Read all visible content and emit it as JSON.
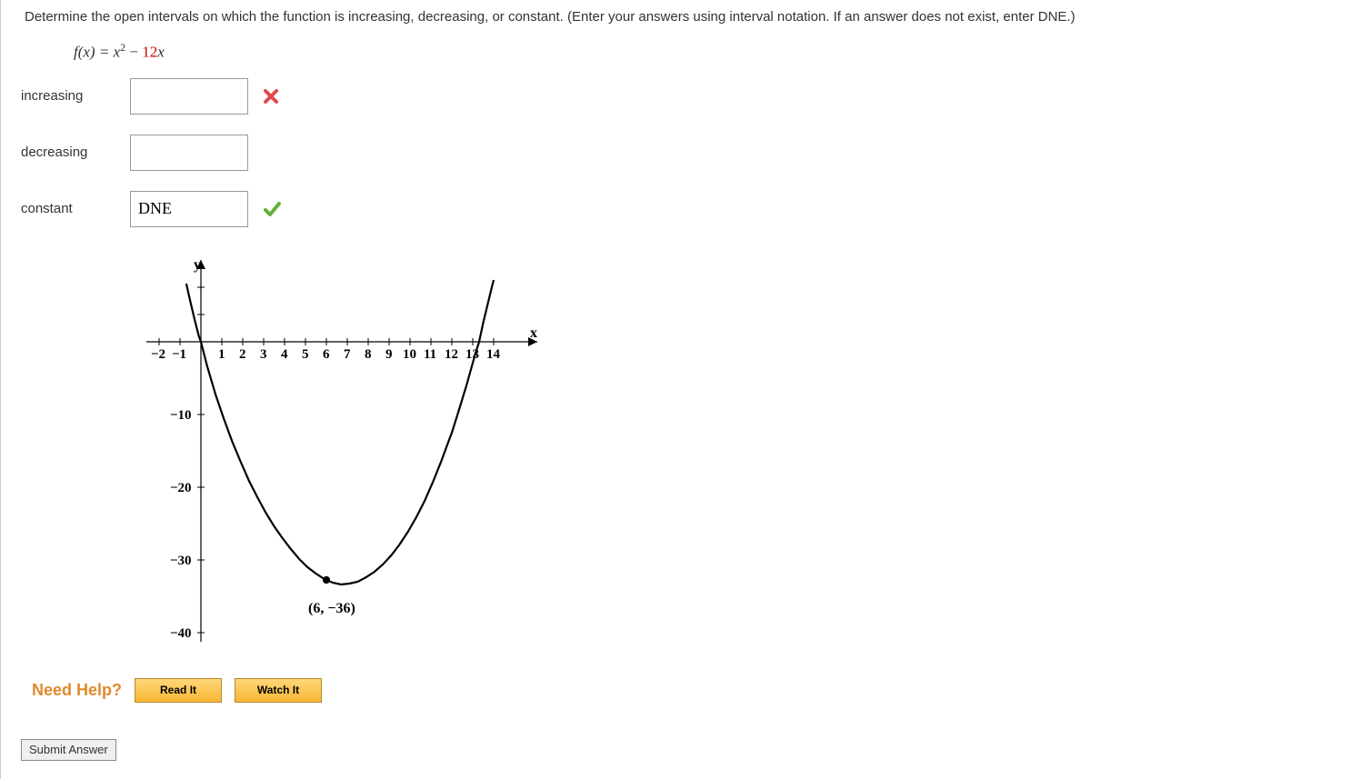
{
  "question": {
    "prompt": "Determine the open intervals on which the function is increasing, decreasing, or constant. (Enter your answers using interval notation. If an answer does not exist, enter DNE.)",
    "formula_prefix": "f(x) = x",
    "formula_exponent": "2",
    "formula_minus": " − ",
    "formula_coeff": "12",
    "formula_suffix": "x"
  },
  "answers": {
    "increasing": {
      "label": "increasing",
      "value": "",
      "mark": "wrong"
    },
    "decreasing": {
      "label": "decreasing",
      "value": "",
      "mark": ""
    },
    "constant": {
      "label": "constant",
      "value": "DNE",
      "mark": "correct"
    }
  },
  "graph": {
    "y_label": "y",
    "x_label": "x",
    "x_ticks": [
      "−2",
      "−1",
      "1",
      "2",
      "3",
      "4",
      "5",
      "6",
      "7",
      "8",
      "9",
      "10",
      "11",
      "12",
      "13",
      "14"
    ],
    "y_ticks": [
      "−10",
      "−20",
      "−30",
      "−40"
    ],
    "vertex_label": "(6, −36)"
  },
  "chart_data": {
    "type": "line",
    "title": "",
    "xlabel": "x",
    "ylabel": "y",
    "xlim": [
      -2,
      14
    ],
    "ylim": [
      -40,
      5
    ],
    "series": [
      {
        "name": "f(x) = x^2 - 12x",
        "x": [
          -1,
          0,
          1,
          2,
          3,
          4,
          5,
          6,
          7,
          8,
          9,
          10,
          11,
          12,
          13
        ],
        "y": [
          13,
          0,
          -11,
          -20,
          -27,
          -32,
          -35,
          -36,
          -35,
          -32,
          -27,
          -20,
          -11,
          0,
          13
        ]
      }
    ],
    "annotations": [
      {
        "x": 6,
        "y": -36,
        "label": "(6, −36)"
      }
    ]
  },
  "help": {
    "title": "Need Help?",
    "read": "Read It",
    "watch": "Watch It"
  },
  "submit": {
    "label": "Submit Answer"
  }
}
